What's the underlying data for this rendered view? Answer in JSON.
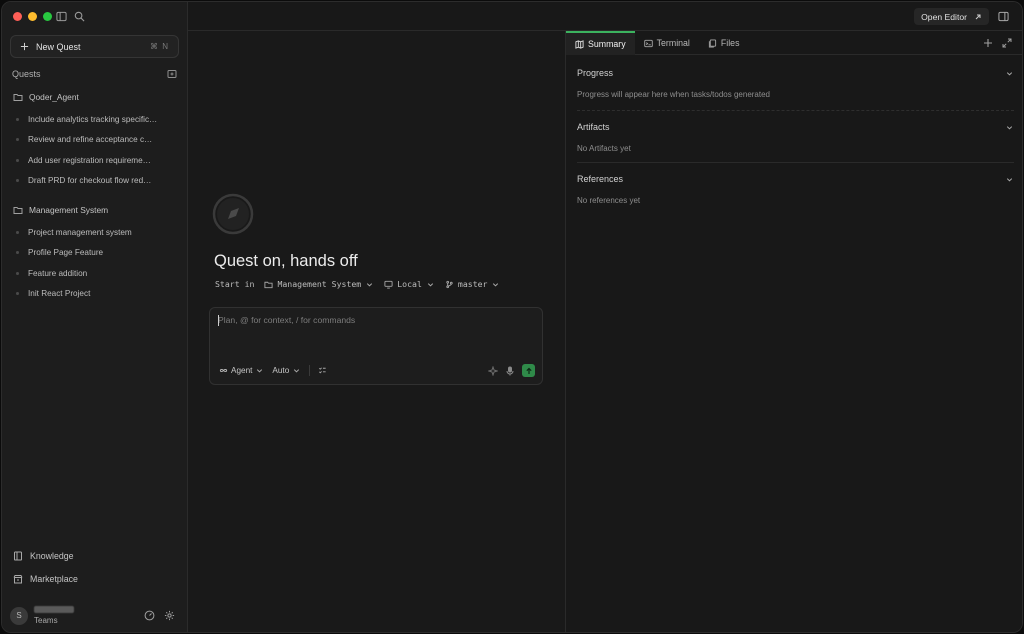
{
  "sidebar": {
    "new_quest": {
      "label": "New Quest",
      "shortcut": "⌘ N"
    },
    "quests_title": "Quests",
    "groups": [
      {
        "title": "Qoder_Agent",
        "items": [
          "Include analytics tracking specific…",
          "Review and refine acceptance c…",
          "Add user registration requireme…",
          "Draft PRD for checkout flow red…"
        ]
      },
      {
        "title": "Management System",
        "items": [
          "Project management system",
          "Profile Page Feature",
          "Feature addition",
          "Init React Project"
        ]
      }
    ],
    "links": {
      "knowledge": "Knowledge",
      "marketplace": "Marketplace"
    },
    "user": {
      "initial": "S",
      "plan": "Teams"
    }
  },
  "topbar": {
    "open_editor": "Open Editor"
  },
  "center": {
    "title": "Quest on, hands off",
    "start_in": "Start in",
    "project": "Management System",
    "env": "Local",
    "branch": "master",
    "placeholder": "Plan, @ for context, / for commands",
    "mode": "Agent",
    "model": "Auto"
  },
  "panel": {
    "tabs": [
      "Summary",
      "Terminal",
      "Files"
    ],
    "sections": [
      {
        "title": "Progress",
        "body": "Progress will appear here when tasks/todos generated"
      },
      {
        "title": "Artifacts",
        "body": "No Artifacts yet"
      },
      {
        "title": "References",
        "body": "No references yet"
      }
    ]
  },
  "colors": {
    "accent": "#3cb35f",
    "send": "#2f8a49"
  }
}
